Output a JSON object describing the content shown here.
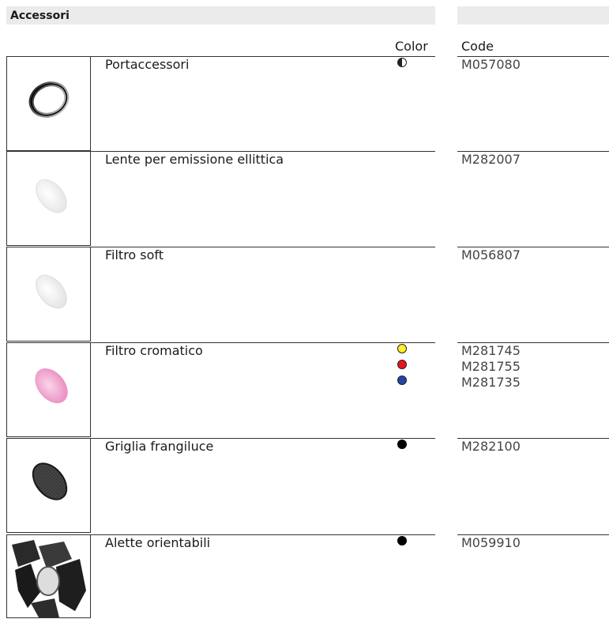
{
  "header": {
    "section_title": "Accessori"
  },
  "columns": {
    "color_label": "Color",
    "code_label": "Code"
  },
  "items": [
    {
      "name": "Portaccessori",
      "image_icon": "ring-holder-icon",
      "colors": [
        "half-tone"
      ],
      "codes": [
        "M057080"
      ]
    },
    {
      "name": "Lente per emissione ellittica",
      "image_icon": "elliptical-lens-icon",
      "colors": [],
      "codes": [
        "M282007"
      ]
    },
    {
      "name": "Filtro soft",
      "image_icon": "soft-filter-icon",
      "colors": [],
      "codes": [
        "M056807"
      ]
    },
    {
      "name": "Filtro cromatico",
      "image_icon": "color-filter-icon",
      "colors": [
        "yellow",
        "red",
        "blue"
      ],
      "codes": [
        "M281745",
        "M281755",
        "M281735"
      ]
    },
    {
      "name": "Griglia frangiluce",
      "image_icon": "honeycomb-grid-icon",
      "colors": [
        "black"
      ],
      "codes": [
        "M282100"
      ]
    },
    {
      "name": "Alette orientabili",
      "image_icon": "barn-doors-icon",
      "colors": [
        "black"
      ],
      "codes": [
        "M059910"
      ]
    }
  ],
  "swatches": {
    "yellow": "#ffef2a",
    "red": "#e8131d",
    "blue": "#2246a8",
    "black": "#000000"
  }
}
